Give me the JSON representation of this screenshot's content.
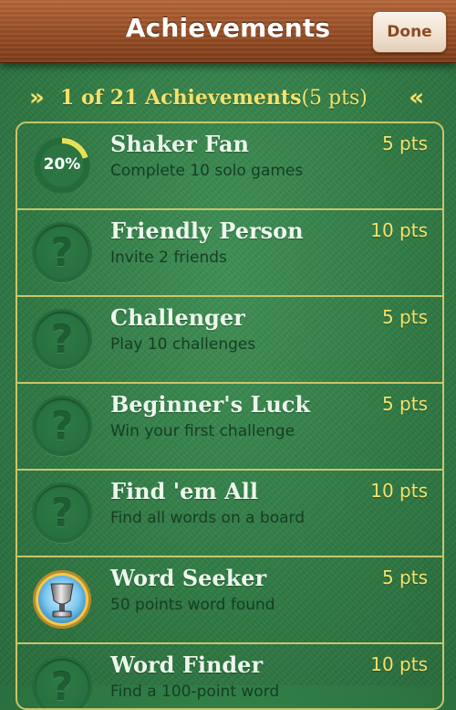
{
  "header": {
    "title": "Achievements",
    "done_label": "Done"
  },
  "summary": {
    "text": "1 of 21 Achievements",
    "points": "(5 pts)"
  },
  "achievements": [
    {
      "title": "Shaker Fan",
      "description": "Complete 10 solo games",
      "points": "5 pts",
      "badge": "progress",
      "progress_label": "20%",
      "progress": 0.2
    },
    {
      "title": "Friendly Person",
      "description": "Invite 2 friends",
      "points": "10 pts",
      "badge": "locked"
    },
    {
      "title": "Challenger",
      "description": "Play 10 challenges",
      "points": "5 pts",
      "badge": "locked"
    },
    {
      "title": "Beginner's Luck",
      "description": "Win your first challenge",
      "points": "5 pts",
      "badge": "locked"
    },
    {
      "title": "Find 'em All",
      "description": "Find all words on a board",
      "points": "10 pts",
      "badge": "locked"
    },
    {
      "title": "Word Seeker",
      "description": "50 points word found",
      "points": "5 pts",
      "badge": "trophy"
    },
    {
      "title": "Word Finder",
      "description": "Find a 100-point word",
      "points": "10 pts",
      "badge": "locked"
    }
  ],
  "icons": {
    "locked": "question-mark-icon",
    "trophy": "trophy-icon",
    "progress": "progress-ring-icon"
  },
  "colors": {
    "accent_yellow": "#f6e16a",
    "felt_green": "#2f7a44",
    "wood_brown": "#9c5228"
  }
}
